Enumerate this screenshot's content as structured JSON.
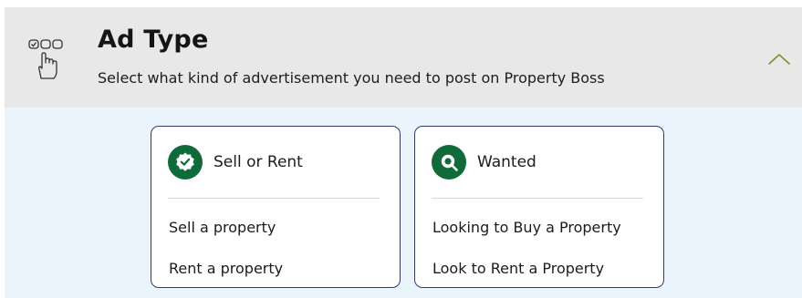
{
  "section": {
    "title": "Ad Type",
    "subtitle": "Select what kind of advertisement you need to post on Property Boss",
    "icon": "select-option-hand-icon",
    "toggle_icon": "chevron-up-icon",
    "accent_color": "#8a8a2a"
  },
  "cards": [
    {
      "title": "Sell or Rent",
      "icon": "verified-badge-icon",
      "options": [
        "Sell a property",
        "Rent a property"
      ]
    },
    {
      "title": "Wanted",
      "icon": "search-icon",
      "options": [
        "Looking to Buy a Property",
        "Look to Rent a Property"
      ]
    }
  ],
  "colors": {
    "header_bg": "#e8e8e8",
    "content_bg": "#eaf4fc",
    "badge_green": "#0f6b3a",
    "card_border": "#3a3a6a"
  }
}
